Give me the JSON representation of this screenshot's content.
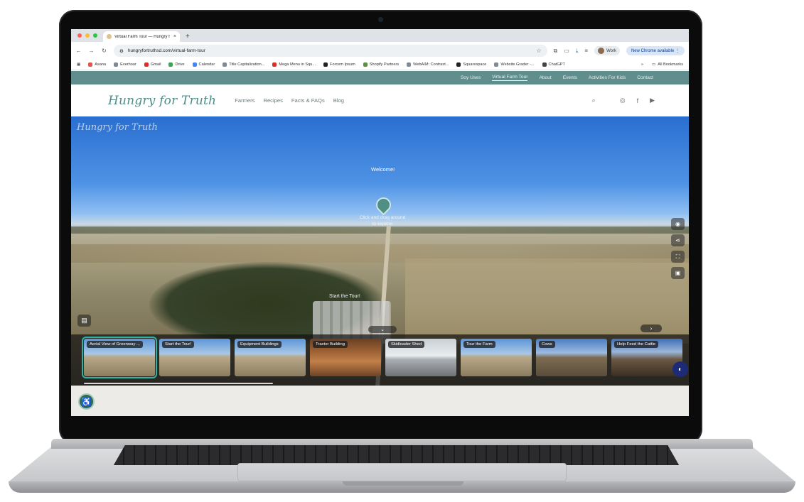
{
  "browser": {
    "tab": {
      "title": "Virtual Farm Tour — Hungry f",
      "close": "×",
      "new_tab": "+"
    },
    "traffic_lights": {
      "red": "#ff5f57",
      "yellow": "#febc2e",
      "green": "#28c840"
    },
    "address": {
      "url": "hungryfortruthsd.com/virtual-farm-tour"
    },
    "profile": "Work",
    "update_button": "New Chrome available",
    "bookmarks": [
      "Asana",
      "Everhour",
      "Gmail",
      "Drive",
      "Calendar",
      "Title Capitalization...",
      "Mega Menu in Squ...",
      "Forcem Ipsum",
      "Shopify Partners",
      "WebAIM: Contrast...",
      "Squarespace",
      "Website Grader -...",
      "ChatGPT"
    ],
    "bookmarks_overflow": "»",
    "all_bookmarks": "All Bookmarks"
  },
  "site": {
    "colors": {
      "teal": "#5f8e8c",
      "logo": "#4f8c87",
      "accent": "#2bb3a3"
    },
    "topnav": [
      "Soy Uses",
      "Virtual Farm Tour",
      "About",
      "Events",
      "Activities For Kids",
      "Contact"
    ],
    "logo": "Hungry for Truth",
    "mainnav": [
      "Farmers",
      "Recipes",
      "Facts & FAQs",
      "Blog"
    ],
    "icons": [
      "search-icon",
      "instagram-icon",
      "facebook-icon",
      "youtube-icon"
    ]
  },
  "tour": {
    "watermark": "Hungry for Truth",
    "welcome": "Welcome!",
    "explore_line1": "Click and drag around",
    "explore_line2": "to explore",
    "start_hint": "Start the Tour!",
    "scenes": [
      "Aerial View of Greenway ...",
      "Start the Tour!",
      "Equipment Buildings",
      "Tractor Building",
      "Skidloader Shed",
      "Tour the Farm",
      "Cows",
      "Help Feed the Cattle"
    ]
  }
}
